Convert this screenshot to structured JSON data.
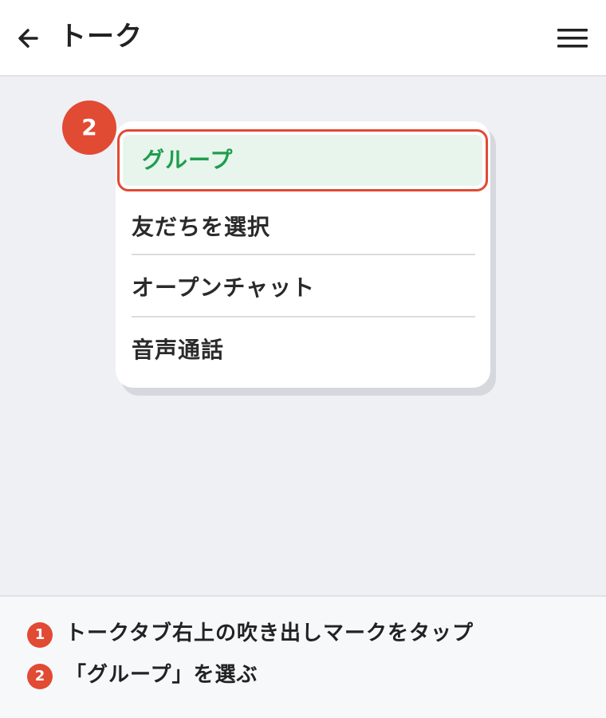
{
  "header": {
    "title": "トーク"
  },
  "menu": {
    "items": [
      {
        "label": "グループ",
        "highlighted": true
      },
      {
        "label": "友だちを選択"
      },
      {
        "label": "オープンチャット"
      },
      {
        "label": "音声通話"
      }
    ]
  },
  "callout": {
    "number": "2"
  },
  "instructions": [
    {
      "number": "1",
      "text": "トークタブ右上の吹き出しマークをタップ"
    },
    {
      "number": "2",
      "text": "「グループ」を選ぶ"
    }
  ],
  "colors": {
    "accent_red": "#e14a33",
    "highlight_green_text": "#1f9e4e",
    "highlight_green_bg": "#e8f5ec",
    "content_bg": "#eff0f4"
  },
  "icons": {
    "back": "back-arrow-icon",
    "menu": "hamburger-menu-icon"
  }
}
